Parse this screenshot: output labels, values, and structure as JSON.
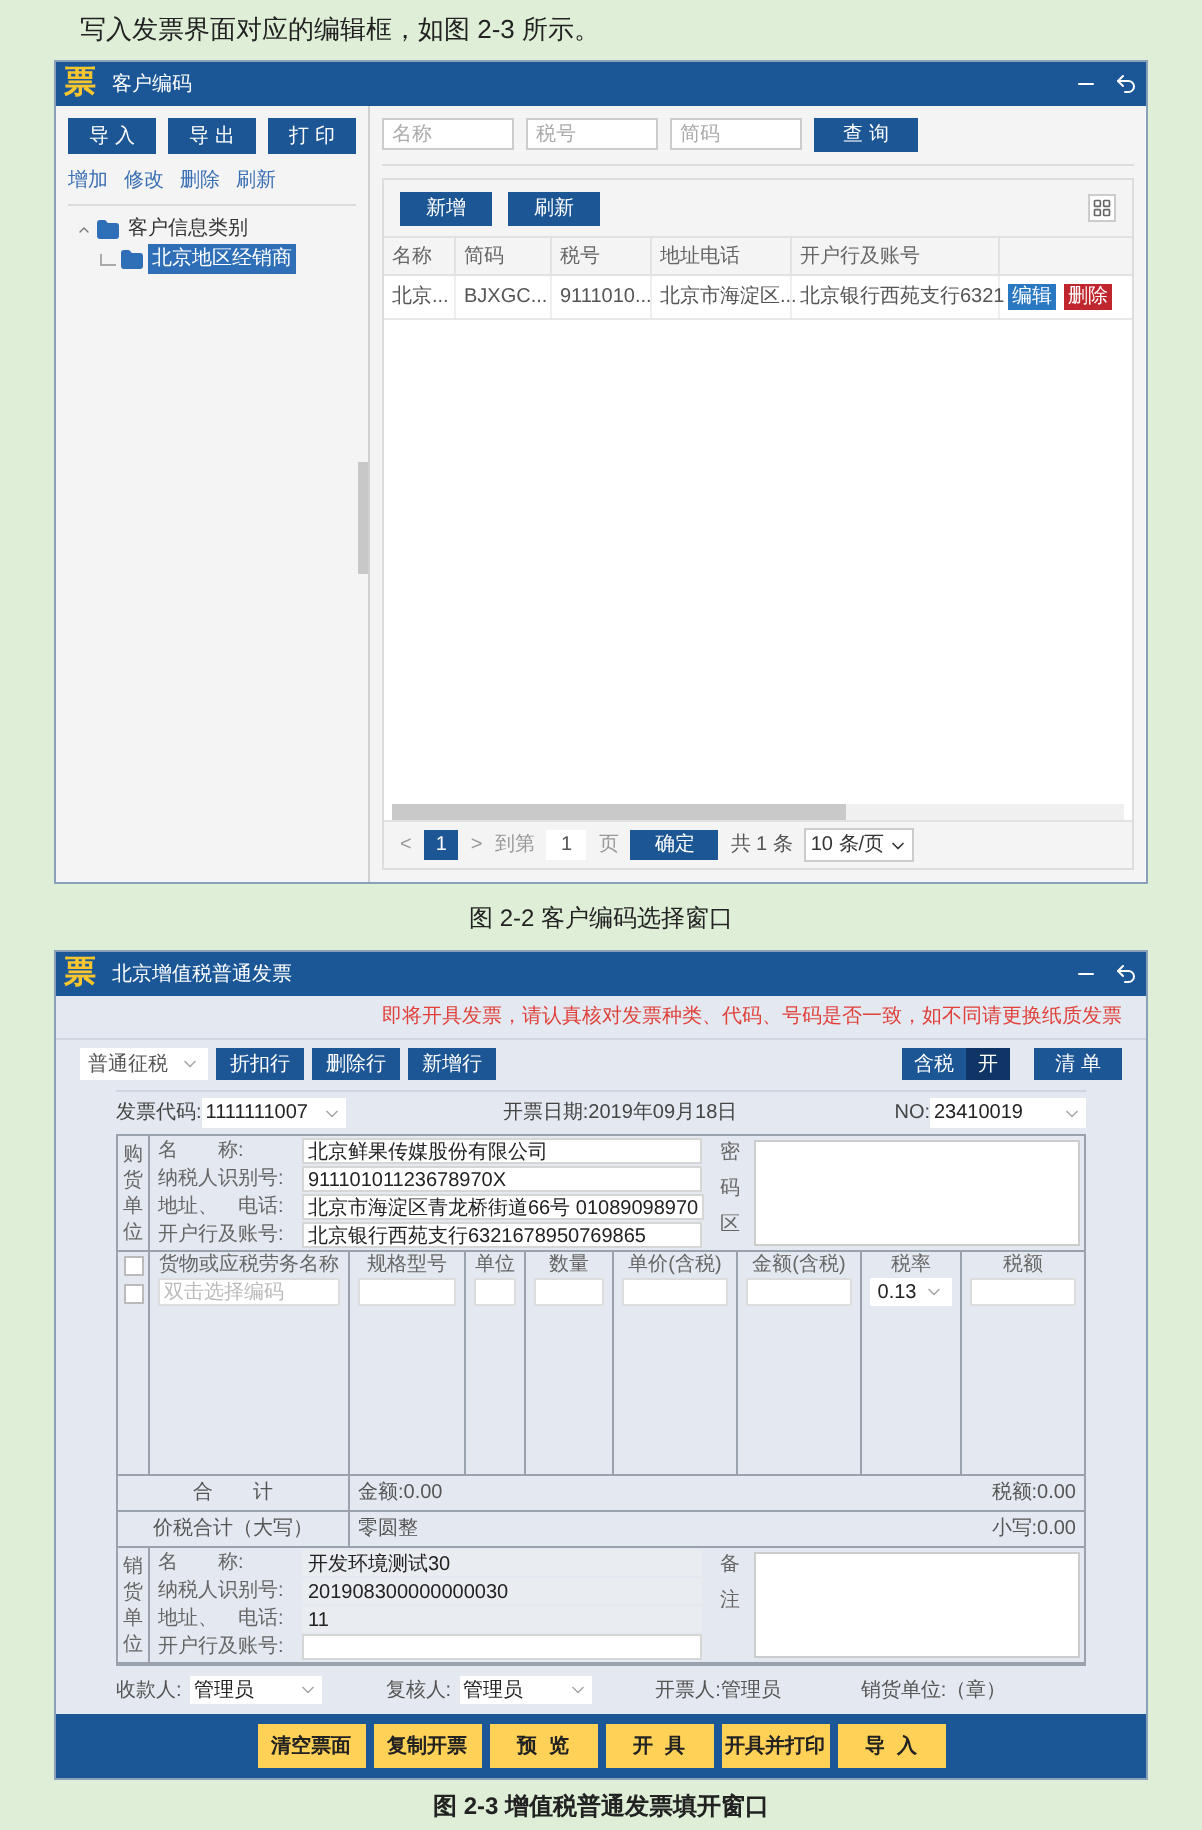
{
  "intro": "写入发票界面对应的编辑框，如图 2-3 所示。",
  "window1": {
    "logo": "票",
    "title": "客户编码",
    "left_buttons": [
      "导 入",
      "导 出",
      "打 印"
    ],
    "links": [
      "增加",
      "修改",
      "删除",
      "刷新"
    ],
    "tree": [
      {
        "label": "客户信息类别",
        "expanded": true,
        "selected": false,
        "children": [
          {
            "label": "北京地区经销商",
            "selected": true
          }
        ]
      }
    ],
    "search_placeholders": [
      "名称",
      "税号",
      "简码"
    ],
    "query_button": "查 询",
    "toolbar": [
      "新增",
      "刷新"
    ],
    "columns": [
      "名称",
      "简码",
      "税号",
      "地址电话",
      "开户行及账号"
    ],
    "rows": [
      {
        "cells": [
          "北京...",
          "BJXGC...",
          "9111010...",
          "北京市海淀区...",
          "北京银行西苑支行6321"
        ],
        "actions": [
          {
            "label": "编辑",
            "kind": "edit"
          },
          {
            "label": "删除",
            "kind": "delete"
          }
        ]
      }
    ],
    "pagination": {
      "prev": "<",
      "pages": [
        {
          "label": "1",
          "selected": true
        }
      ],
      "next": ">",
      "goto_label": "到第",
      "goto_value": "1",
      "page_unit": "页",
      "confirm": "确定",
      "total": "共 1 条",
      "page_size": "10 条/页"
    }
  },
  "caption1": "图 2-2 客户编码选择窗口",
  "window2": {
    "logo": "票",
    "title": "北京增值税普通发票",
    "notice": "即将开具发票，请认真核对发票种类、代码、号码是否一致，如不同请更换纸质发票",
    "type_select": "普通征税",
    "row_buttons": [
      "折扣行",
      "删除行",
      "新增行"
    ],
    "tax_toggle": {
      "label": "含税",
      "value": "开",
      "on": true
    },
    "list_button": "清 单",
    "code_label": "发票代码:",
    "code": "1111111007",
    "date": "开票日期:2019年09月18日",
    "no_label": "NO:",
    "no": "23410019",
    "buyer": {
      "side_label": "购货单位",
      "aside_label": "密码区",
      "fields": [
        {
          "label": "名　　称:",
          "value": "北京鲜果传媒股份有限公司",
          "readonly": false
        },
        {
          "label": "纳税人识别号:",
          "value": "91110101123678970X",
          "readonly": false
        },
        {
          "label": "地址、　电话:",
          "value": "北京市海淀区青龙桥街道66号 01089098970",
          "readonly": false
        },
        {
          "label": "开户行及账号:",
          "value": "北京银行西苑支行6321678950769865",
          "readonly": false
        }
      ]
    },
    "item_columns": [
      "货物或应税劳务名称",
      "规格型号",
      "单位",
      "数量",
      "单价(含税)",
      "金额(含税)",
      "税率",
      "税额"
    ],
    "header_checkbox": {
      "checked": false
    },
    "rows": [
      {
        "checked": false,
        "name_placeholder": "双击选择编码",
        "tax_rate": "0.13"
      }
    ],
    "totals": {
      "label": "合　　计",
      "amount": "金额:0.00",
      "tax": "税额:0.00"
    },
    "grand_total": {
      "label": "价税合计（大写）",
      "words": "零圆整",
      "figure": "小写:0.00"
    },
    "seller": {
      "side_label": "销货单位",
      "aside_label": "备注",
      "fields": [
        {
          "label": "名　　称:",
          "value": "开发环境测试30",
          "readonly": true
        },
        {
          "label": "纳税人识别号:",
          "value": "201908300000000030",
          "readonly": true
        },
        {
          "label": "地址、　电话:",
          "value": "11",
          "readonly": true
        },
        {
          "label": "开户行及账号:",
          "readonly": false
        }
      ]
    },
    "payee_label": "收款人:",
    "payee": "管理员",
    "reviewer_label": "复核人:",
    "reviewer": "管理员",
    "issuer": "开票人:管理员",
    "seller_seal": "销货单位:（章）",
    "bottom_buttons": [
      "清空票面",
      "复制开票",
      "预  览",
      "开  具",
      "开具并打印",
      "导  入"
    ]
  },
  "caption2": "图 2-3 增值税普通发票填开窗口"
}
